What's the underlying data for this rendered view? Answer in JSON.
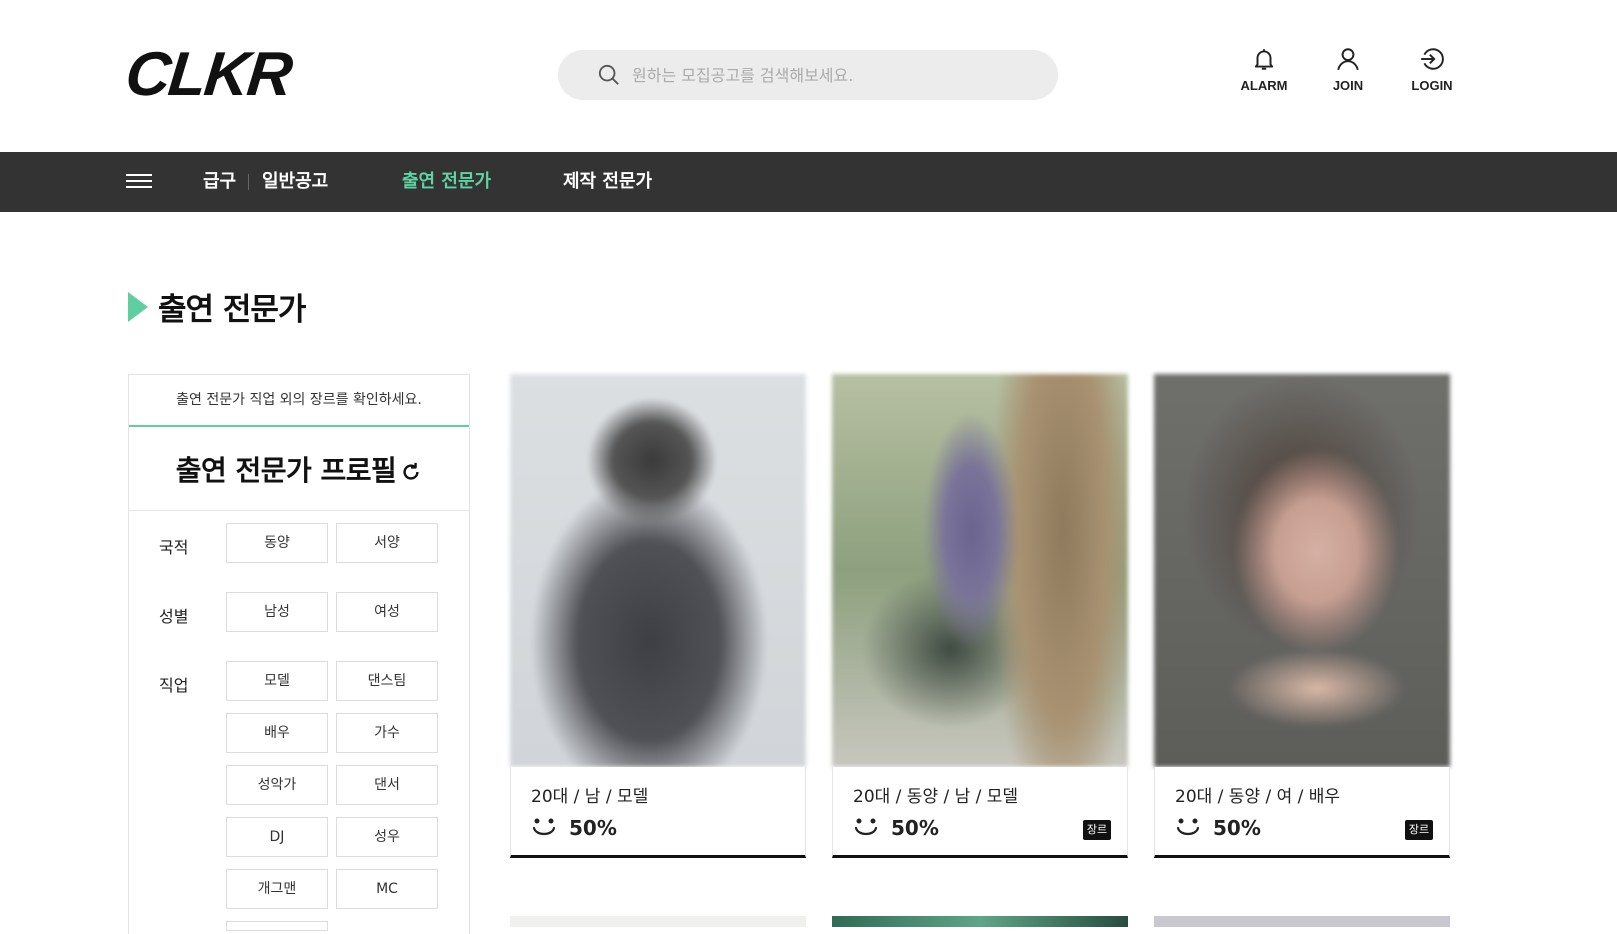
{
  "header": {
    "logo": "CLKR",
    "search_placeholder": "원하는 모집공고를 검색해보세요.",
    "actions": [
      {
        "label": "ALARM",
        "icon": "bell-icon"
      },
      {
        "label": "JOIN",
        "icon": "user-icon"
      },
      {
        "label": "LOGIN",
        "icon": "login-icon"
      }
    ]
  },
  "nav": {
    "items": [
      {
        "label": "급구"
      },
      {
        "label": "일반공고"
      },
      {
        "label": "출연 전문가",
        "active": true
      },
      {
        "label": "제작 전문가"
      }
    ]
  },
  "page_title": "출연 전문가",
  "filter": {
    "notice": "출연 전문가 직업 외의 장르를 확인하세요.",
    "title": "출연 전문가 프로필",
    "groups": [
      {
        "label": "국적",
        "options": [
          "동양",
          "서양"
        ]
      },
      {
        "label": "성별",
        "options": [
          "남성",
          "여성"
        ]
      },
      {
        "label": "직업",
        "options": [
          "모델",
          "댄스팀",
          "배우",
          "가수",
          "성악가",
          "댄서",
          "DJ",
          "성우",
          "개그맨",
          "MC"
        ]
      }
    ]
  },
  "cards": [
    {
      "meta": "20대 / 남 / 모델",
      "score": "50%",
      "badge": null
    },
    {
      "meta": "20대 / 동양 / 남 / 모델",
      "score": "50%",
      "badge": "장르"
    },
    {
      "meta": "20대 / 동양 / 여 / 배우",
      "score": "50%",
      "badge": "장르"
    }
  ],
  "colors": {
    "accent": "#5fcfa0",
    "nav_bg": "#333333",
    "search_bg": "#ececec"
  }
}
